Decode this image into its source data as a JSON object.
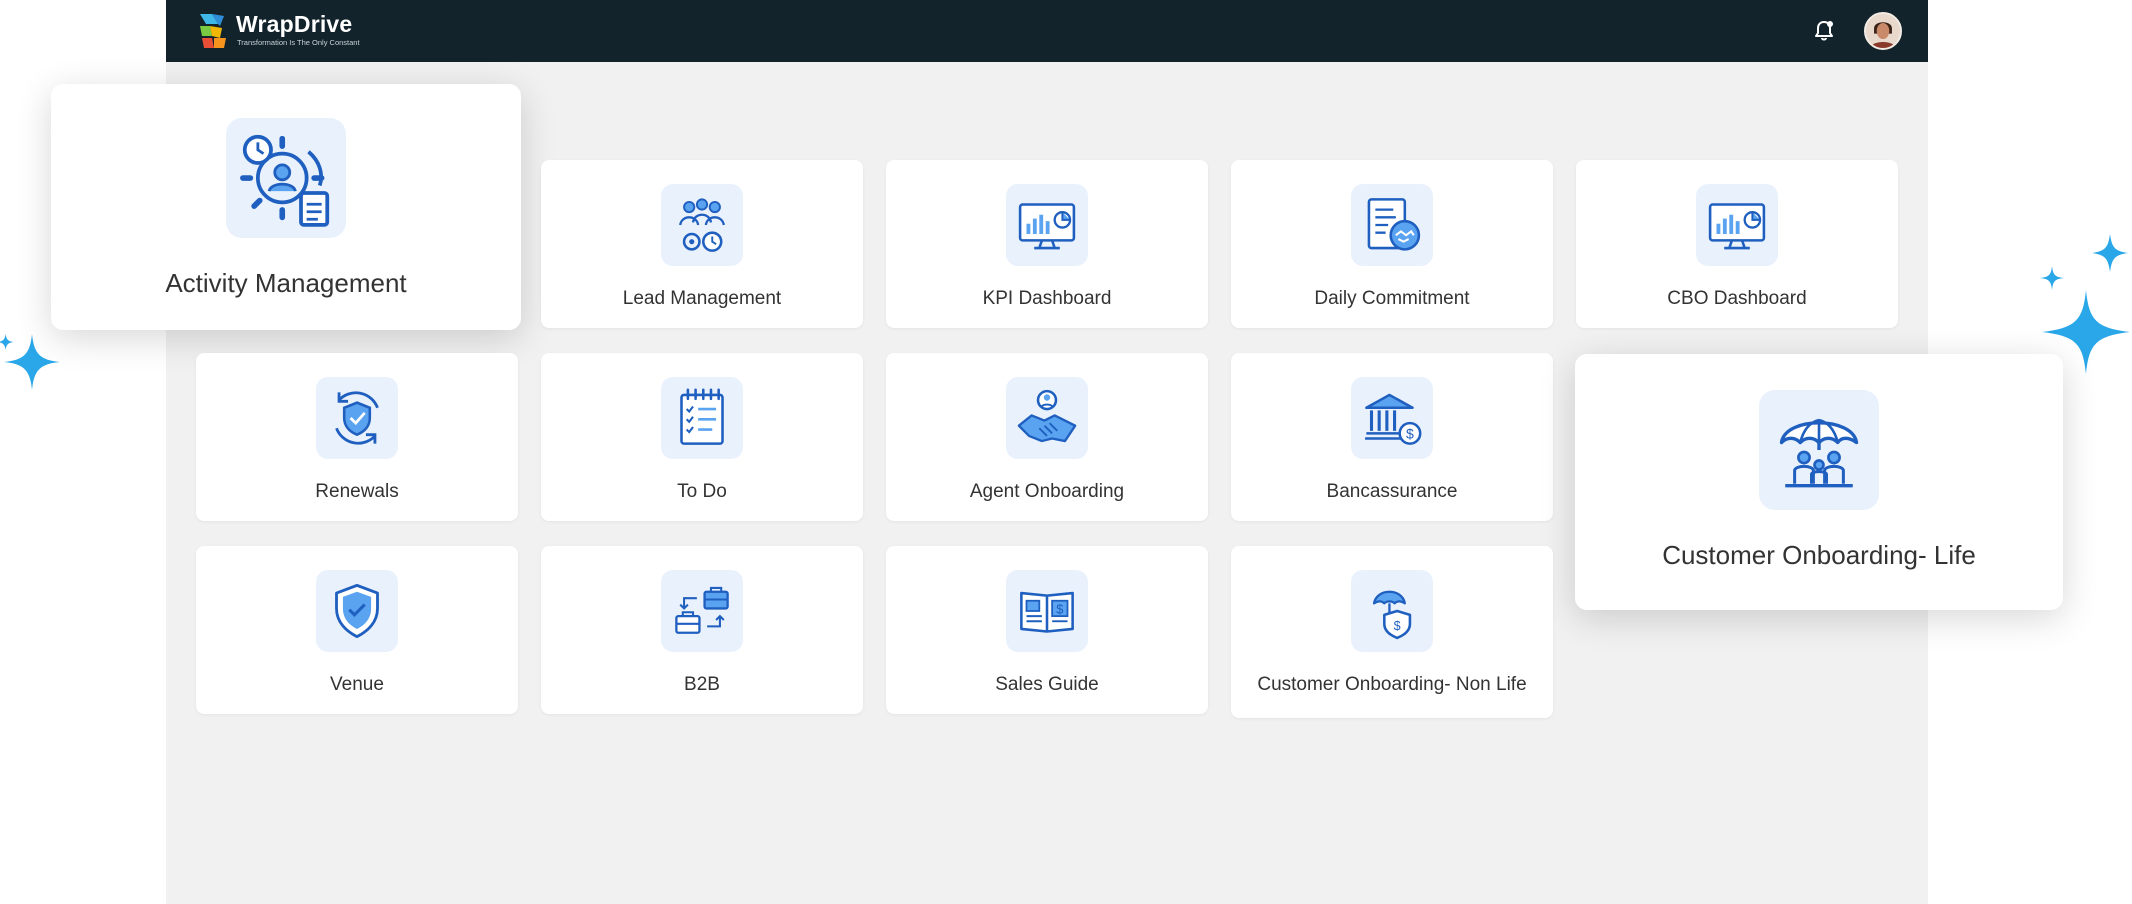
{
  "app": {
    "brand": "WrapDrive",
    "tagline": "Transformation Is The Only Constant"
  },
  "header": {
    "icons": [
      "bell-icon",
      "avatar"
    ]
  },
  "colors": {
    "topbar": "#13232b",
    "icon_stroke": "#1f5fbf",
    "icon_fill": "#5aa3f0",
    "icon_bg": "#e9f1fd",
    "sparkle": "#2aa7e8",
    "page_bg": "#f1f1f1"
  },
  "modules": [
    {
      "label": "Activity Management",
      "icon": "activity-management-icon",
      "highlighted": true
    },
    {
      "label": "Lead Management",
      "icon": "lead-management-icon"
    },
    {
      "label": "KPI Dashboard",
      "icon": "kpi-dashboard-icon"
    },
    {
      "label": "Daily Commitment",
      "icon": "daily-commitment-icon"
    },
    {
      "label": "CBO Dashboard",
      "icon": "cbo-dashboard-icon"
    },
    {
      "label": "Renewals",
      "icon": "renewals-icon"
    },
    {
      "label": "To Do",
      "icon": "to-do-icon"
    },
    {
      "label": "Agent Onboarding",
      "icon": "agent-onboarding-icon"
    },
    {
      "label": "Bancassurance",
      "icon": "bancassurance-icon"
    },
    {
      "label": "Customer Onboarding- Life",
      "icon": "customer-onboarding-life-icon",
      "highlighted": true
    },
    {
      "label": "Venue",
      "icon": "venue-icon"
    },
    {
      "label": "B2B",
      "icon": "b2b-icon"
    },
    {
      "label": "Sales Guide",
      "icon": "sales-guide-icon"
    },
    {
      "label": "Customer Onboarding- Non Life",
      "icon": "customer-onboarding-non-life-icon"
    }
  ]
}
